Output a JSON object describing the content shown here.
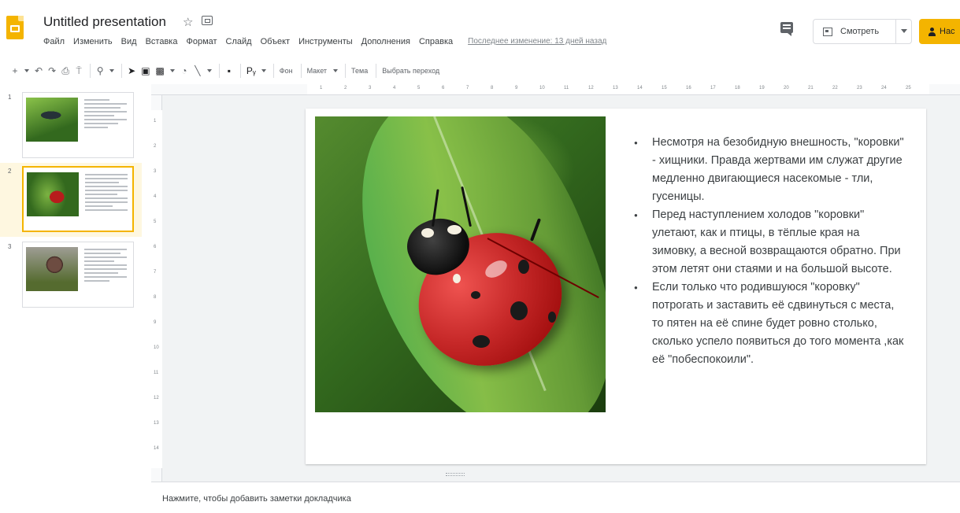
{
  "app": {
    "doc_title": "Untitled presentation",
    "last_edit": "Последнее изменение: 13 дней назад"
  },
  "menu": [
    "Файл",
    "Изменить",
    "Вид",
    "Вставка",
    "Формат",
    "Слайд",
    "Объект",
    "Инструменты",
    "Дополнения",
    "Справка"
  ],
  "header_right": {
    "present_label": "Смотреть",
    "share_label": "Нас"
  },
  "toolbar": {
    "background_label": "Фон",
    "layout_label": "Макет",
    "theme_label": "Тема",
    "transition_label": "Выбрать переход"
  },
  "filmstrip": {
    "slides": [
      {
        "number": "1"
      },
      {
        "number": "2"
      },
      {
        "number": "3"
      }
    ]
  },
  "ruler": {
    "h": [
      "1",
      "2",
      "3",
      "4",
      "5",
      "6",
      "7",
      "8",
      "9",
      "10",
      "11",
      "12",
      "13",
      "14",
      "15",
      "16",
      "17",
      "18",
      "19",
      "20",
      "21",
      "22",
      "23",
      "24",
      "25"
    ],
    "v": [
      "1",
      "2",
      "3",
      "4",
      "5",
      "6",
      "7",
      "8",
      "9",
      "10",
      "11",
      "12",
      "13",
      "14"
    ]
  },
  "slide": {
    "bullets": [
      "Несмотря на безобидную внешность, \"коровки\" - хищники. Правда жертвами им служат другие медленно двигающиеся насекомые - тли, гусеницы.",
      "Перед наступлением холодов \"коровки\" улетают, как и птицы, в тёплые края на зимовку, а весной возвращаются обратно. При этом летят они стаями и на большой высоте.",
      "Если только что родившуюся \"коровку\" потрогать и заставить её сдвинуться с места, то пятен на её спине будет ровно столько, сколько успело появиться до того момента ,как её \"побеспокоили\"."
    ]
  },
  "notes": {
    "placeholder": "Нажмите, чтобы добавить заметки докладчика"
  },
  "colors": {
    "accent": "#f4b400",
    "selected_row": "#fef7e0"
  }
}
